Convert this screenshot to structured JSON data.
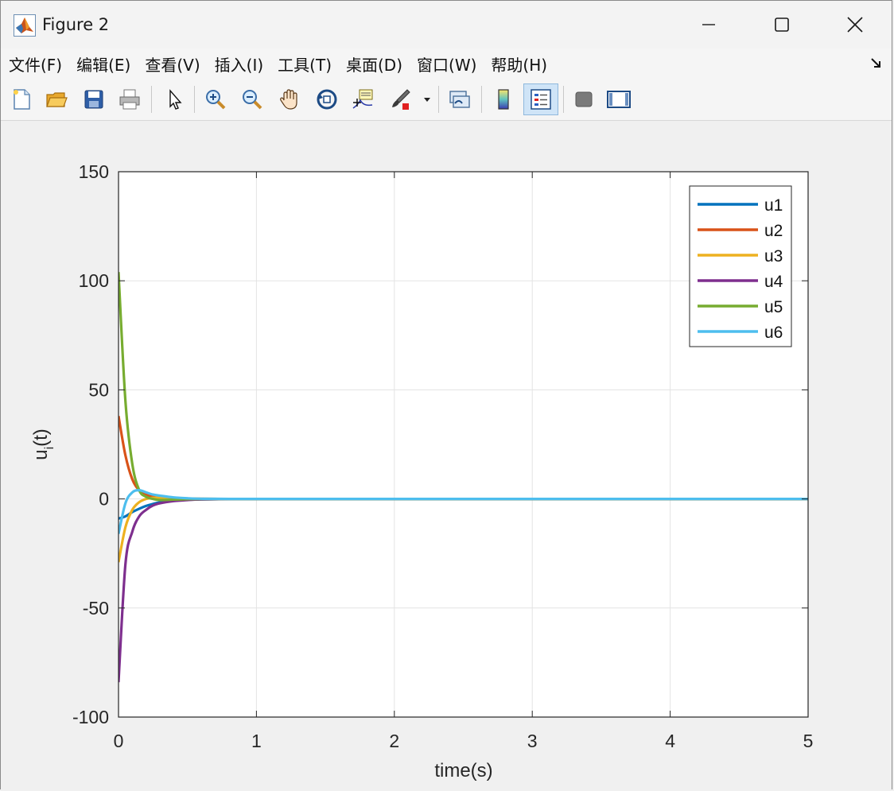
{
  "window": {
    "title": "Figure 2",
    "minimize_label": "minimize",
    "maximize_label": "maximize",
    "close_label": "close"
  },
  "menu": {
    "items": [
      {
        "id": "file",
        "label": "文件(F)"
      },
      {
        "id": "edit",
        "label": "编辑(E)"
      },
      {
        "id": "view",
        "label": "查看(V)"
      },
      {
        "id": "insert",
        "label": "插入(I)"
      },
      {
        "id": "tools",
        "label": "工具(T)"
      },
      {
        "id": "desktop",
        "label": "桌面(D)"
      },
      {
        "id": "window",
        "label": "窗口(W)"
      },
      {
        "id": "help",
        "label": "帮助(H)"
      }
    ]
  },
  "toolbar": {
    "icons": [
      "new-figure-icon",
      "open-folder-icon",
      "save-icon",
      "print-icon",
      "pointer-icon",
      "zoom-in-icon",
      "zoom-out-icon",
      "pan-hand-icon",
      "rotate-3d-icon",
      "data-cursor-icon",
      "brush-icon",
      "brush-dropdown-icon",
      "link-plot-icon",
      "colorbar-icon",
      "legend-icon",
      "hide-plot-tools-icon",
      "show-plot-tools-icon"
    ],
    "active": "legend-icon"
  },
  "chart_data": {
    "type": "line",
    "title": "",
    "xlabel": "time(s)",
    "ylabel": "u_i(t)",
    "xlim": [
      0,
      5
    ],
    "ylim": [
      -100,
      150
    ],
    "xticks": [
      0,
      1,
      2,
      3,
      4,
      5
    ],
    "yticks": [
      -100,
      -50,
      0,
      50,
      100,
      150
    ],
    "xtick_labels": [
      "0",
      "1",
      "2",
      "3",
      "4",
      "5"
    ],
    "ytick_labels": [
      "-100",
      "-50",
      "0",
      "50",
      "100",
      "150"
    ],
    "grid": true,
    "legend_position": "top-right",
    "x": [
      0,
      0.05,
      0.1,
      0.15,
      0.2,
      0.25,
      0.3,
      0.4,
      0.5,
      0.6,
      0.8,
      1.0,
      1.5,
      2,
      3,
      4,
      5
    ],
    "series": [
      {
        "name": "u1",
        "color": "#0072BD",
        "values": [
          -9,
          -8,
          -6,
          -4.5,
          -3.2,
          -2.3,
          -1.6,
          -0.8,
          -0.4,
          -0.2,
          -0.05,
          0,
          0,
          0,
          0,
          0,
          0
        ]
      },
      {
        "name": "u2",
        "color": "#D95319",
        "values": [
          38,
          20,
          9,
          4,
          2,
          1,
          0.5,
          0.2,
          0.1,
          0.05,
          0,
          0,
          0,
          0,
          0,
          0,
          0
        ]
      },
      {
        "name": "u3",
        "color": "#EDB120",
        "values": [
          -29,
          -13,
          -5,
          -1.5,
          0,
          0.5,
          0.5,
          0.3,
          0.15,
          0.05,
          0,
          0,
          0,
          0,
          0,
          0,
          0
        ]
      },
      {
        "name": "u4",
        "color": "#7E2F8E",
        "values": [
          -84,
          -30,
          -15,
          -8,
          -5,
          -3,
          -2,
          -1,
          -0.5,
          -0.2,
          -0.05,
          0,
          0,
          0,
          0,
          0,
          0
        ]
      },
      {
        "name": "u5",
        "color": "#77AC30",
        "values": [
          104,
          45,
          16,
          4,
          1,
          0,
          -0.5,
          -0.3,
          -0.1,
          0,
          0,
          0,
          0,
          0,
          0,
          0,
          0
        ]
      },
      {
        "name": "u6",
        "color": "#4DBEEE",
        "values": [
          -16,
          -2,
          3,
          4,
          3,
          2,
          1.5,
          0.7,
          0.3,
          0.1,
          0,
          0,
          0,
          0,
          0,
          0,
          0
        ]
      }
    ]
  }
}
